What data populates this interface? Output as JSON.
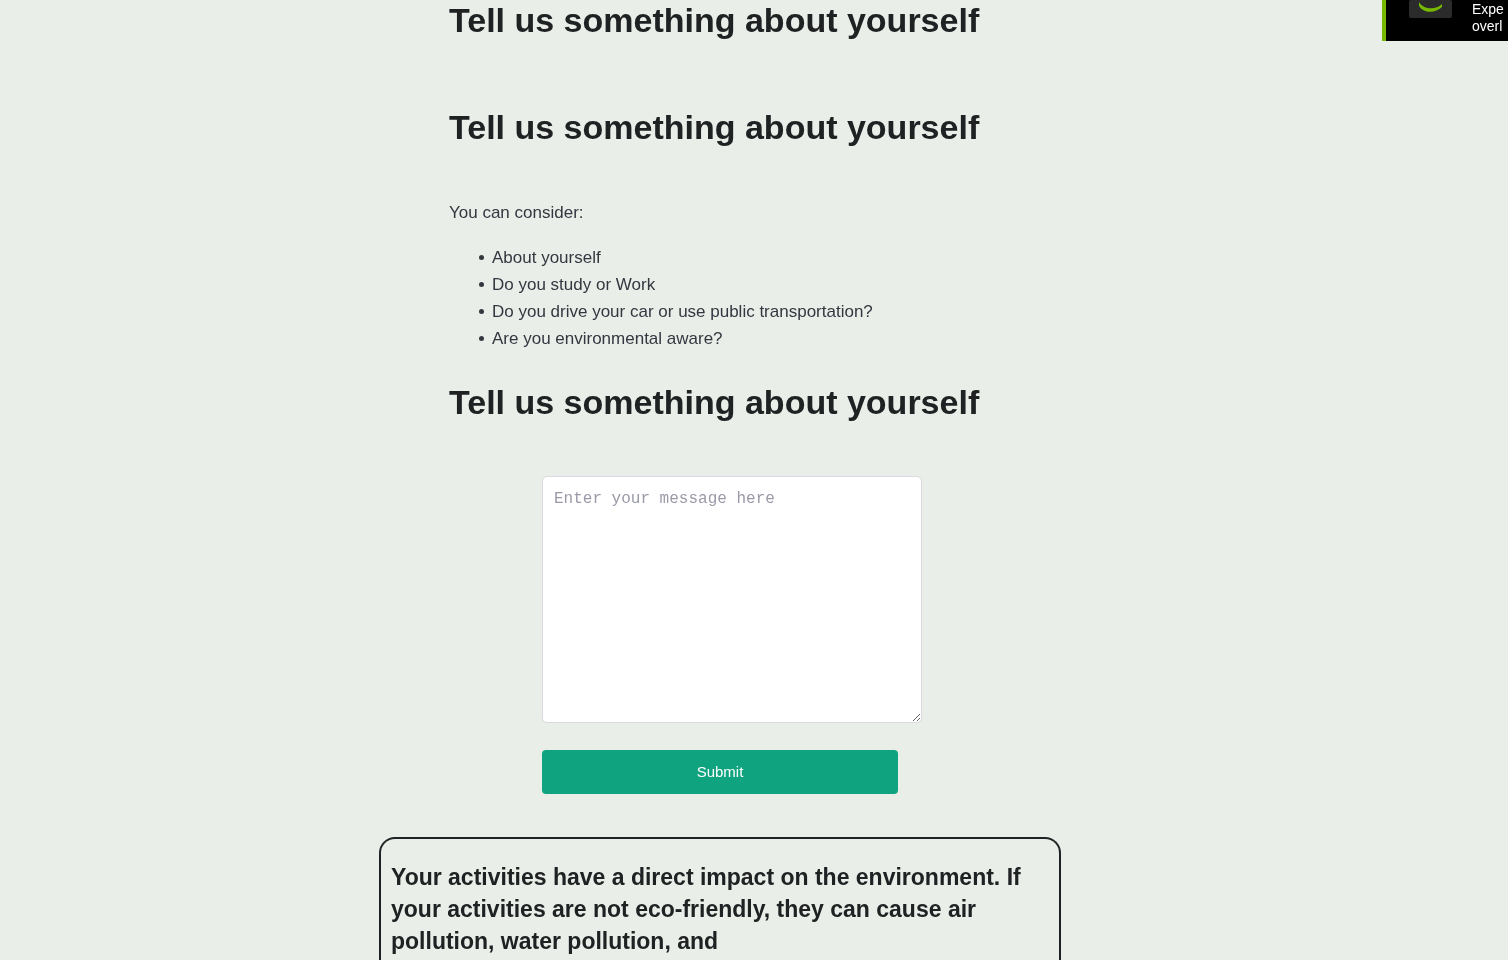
{
  "overlay": {
    "lines": [
      "Expe",
      "overl"
    ]
  },
  "sections": [
    {
      "heading": "Tell us something about yourself"
    },
    {
      "heading": "Tell us something about yourself",
      "intro": "You can consider:",
      "items": [
        "About yourself",
        "Do you study or Work",
        "Do you drive your car or use public transportation?",
        "Are you environmental aware?"
      ]
    },
    {
      "heading": "Tell us something about yourself"
    }
  ],
  "form": {
    "message": {
      "placeholder": "Enter your message here"
    },
    "submit": "Submit"
  },
  "result_box": {
    "text": "Your activities have a direct impact on the environment. If your activities are not eco-friendly, they can cause air pollution, water pollution, and"
  }
}
